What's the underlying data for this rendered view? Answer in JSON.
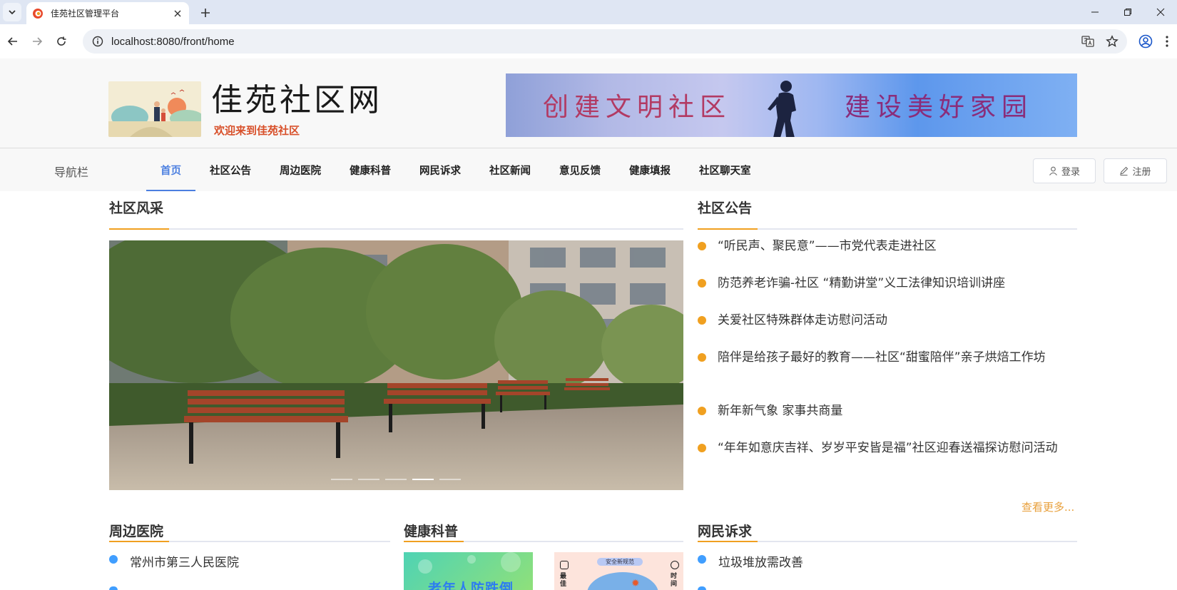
{
  "browser": {
    "tab_title": "佳苑社区管理平台",
    "url": "localhost:8080/front/home"
  },
  "header": {
    "site_title": "佳苑社区网",
    "site_subtitle": "欢迎来到佳苑社区",
    "banner_left": "创建文明社区",
    "banner_right": "建设美好家园"
  },
  "navbar": {
    "label": "导航栏",
    "items": [
      "首页",
      "社区公告",
      "周边医院",
      "健康科普",
      "网民诉求",
      "社区新闻",
      "意见反馈",
      "健康填报",
      "社区聊天室"
    ],
    "active_index": 0,
    "login": "登录",
    "register": "注册"
  },
  "sections": {
    "showcase": "社区风采",
    "notices": "社区公告",
    "hospitals": "周边医院",
    "health": "健康科普",
    "appeals": "网民诉求"
  },
  "notices": [
    "“听民声、聚民意”——市党代表走进社区",
    "防范养老诈骗-社区 “精勤讲堂”义工法律知识培训讲座",
    "关爱社区特殊群体走访慰问活动",
    "陪伴是给孩子最好的教育——社区“甜蜜陪伴”亲子烘焙工作坊",
    "新年新气象 家事共商量",
    "“年年如意庆吉祥、岁岁平安皆是福”社区迎春送福探访慰问活动"
  ],
  "more_link": "查看更多...",
  "carousel": {
    "slide_count": 5,
    "active_slide": 4
  },
  "hospitals": [
    "常州市第三人民医院"
  ],
  "appeals": [
    "垃圾堆放需改善"
  ],
  "health_cards": [
    {
      "caption": "老年人防跌倒"
    },
    {
      "caption": "安全新规范",
      "left_text": "最佳",
      "right_text": "时间"
    }
  ],
  "colors": {
    "accent": "#f0a020",
    "nav_active": "#4b7fe0",
    "bullet_blue": "#409eff",
    "more": "#e8a03c"
  }
}
